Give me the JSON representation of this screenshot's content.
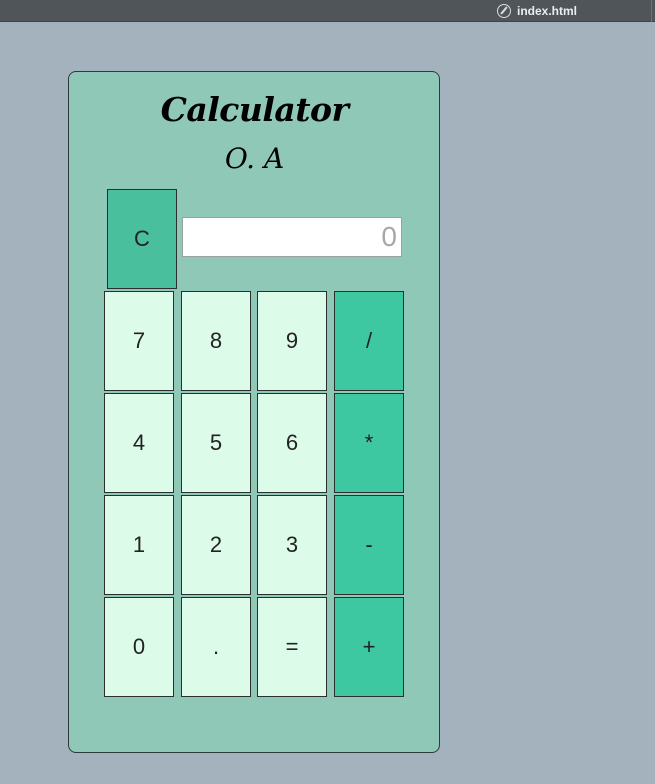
{
  "browser": {
    "tab_title": "index.html",
    "tab_icon": "compass-icon"
  },
  "calculator": {
    "title": "Calculator",
    "subtitle": "O. A",
    "display_value": "0",
    "clear_label": "C",
    "rows": [
      [
        "7",
        "8",
        "9",
        "/"
      ],
      [
        "4",
        "5",
        "6",
        "*"
      ],
      [
        "1",
        "2",
        "3",
        "-"
      ],
      [
        "0",
        ".",
        "=",
        "+"
      ]
    ]
  },
  "colors": {
    "background": "#a3b2bd",
    "card": "#90c8b8",
    "key": "#dcfbe9",
    "operator_key": "#3dc8a2",
    "clear_key": "#4abf9d"
  }
}
